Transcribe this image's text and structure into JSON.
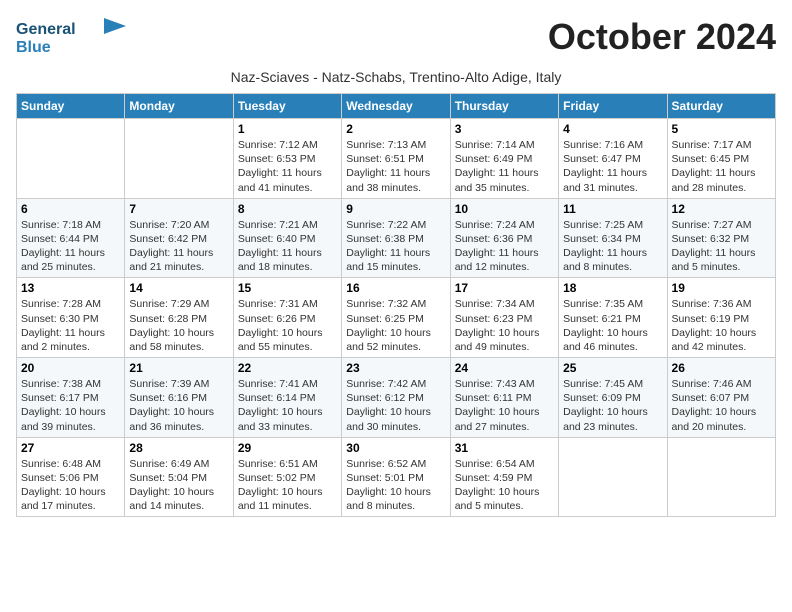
{
  "header": {
    "logo_line1": "General",
    "logo_line2": "Blue",
    "month_title": "October 2024",
    "subtitle": "Naz-Sciaves - Natz-Schabs, Trentino-Alto Adige, Italy"
  },
  "days_of_week": [
    "Sunday",
    "Monday",
    "Tuesday",
    "Wednesday",
    "Thursday",
    "Friday",
    "Saturday"
  ],
  "weeks": [
    [
      {
        "day": "",
        "detail": ""
      },
      {
        "day": "",
        "detail": ""
      },
      {
        "day": "1",
        "detail": "Sunrise: 7:12 AM\nSunset: 6:53 PM\nDaylight: 11 hours and 41 minutes."
      },
      {
        "day": "2",
        "detail": "Sunrise: 7:13 AM\nSunset: 6:51 PM\nDaylight: 11 hours and 38 minutes."
      },
      {
        "day": "3",
        "detail": "Sunrise: 7:14 AM\nSunset: 6:49 PM\nDaylight: 11 hours and 35 minutes."
      },
      {
        "day": "4",
        "detail": "Sunrise: 7:16 AM\nSunset: 6:47 PM\nDaylight: 11 hours and 31 minutes."
      },
      {
        "day": "5",
        "detail": "Sunrise: 7:17 AM\nSunset: 6:45 PM\nDaylight: 11 hours and 28 minutes."
      }
    ],
    [
      {
        "day": "6",
        "detail": "Sunrise: 7:18 AM\nSunset: 6:44 PM\nDaylight: 11 hours and 25 minutes."
      },
      {
        "day": "7",
        "detail": "Sunrise: 7:20 AM\nSunset: 6:42 PM\nDaylight: 11 hours and 21 minutes."
      },
      {
        "day": "8",
        "detail": "Sunrise: 7:21 AM\nSunset: 6:40 PM\nDaylight: 11 hours and 18 minutes."
      },
      {
        "day": "9",
        "detail": "Sunrise: 7:22 AM\nSunset: 6:38 PM\nDaylight: 11 hours and 15 minutes."
      },
      {
        "day": "10",
        "detail": "Sunrise: 7:24 AM\nSunset: 6:36 PM\nDaylight: 11 hours and 12 minutes."
      },
      {
        "day": "11",
        "detail": "Sunrise: 7:25 AM\nSunset: 6:34 PM\nDaylight: 11 hours and 8 minutes."
      },
      {
        "day": "12",
        "detail": "Sunrise: 7:27 AM\nSunset: 6:32 PM\nDaylight: 11 hours and 5 minutes."
      }
    ],
    [
      {
        "day": "13",
        "detail": "Sunrise: 7:28 AM\nSunset: 6:30 PM\nDaylight: 11 hours and 2 minutes."
      },
      {
        "day": "14",
        "detail": "Sunrise: 7:29 AM\nSunset: 6:28 PM\nDaylight: 10 hours and 58 minutes."
      },
      {
        "day": "15",
        "detail": "Sunrise: 7:31 AM\nSunset: 6:26 PM\nDaylight: 10 hours and 55 minutes."
      },
      {
        "day": "16",
        "detail": "Sunrise: 7:32 AM\nSunset: 6:25 PM\nDaylight: 10 hours and 52 minutes."
      },
      {
        "day": "17",
        "detail": "Sunrise: 7:34 AM\nSunset: 6:23 PM\nDaylight: 10 hours and 49 minutes."
      },
      {
        "day": "18",
        "detail": "Sunrise: 7:35 AM\nSunset: 6:21 PM\nDaylight: 10 hours and 46 minutes."
      },
      {
        "day": "19",
        "detail": "Sunrise: 7:36 AM\nSunset: 6:19 PM\nDaylight: 10 hours and 42 minutes."
      }
    ],
    [
      {
        "day": "20",
        "detail": "Sunrise: 7:38 AM\nSunset: 6:17 PM\nDaylight: 10 hours and 39 minutes."
      },
      {
        "day": "21",
        "detail": "Sunrise: 7:39 AM\nSunset: 6:16 PM\nDaylight: 10 hours and 36 minutes."
      },
      {
        "day": "22",
        "detail": "Sunrise: 7:41 AM\nSunset: 6:14 PM\nDaylight: 10 hours and 33 minutes."
      },
      {
        "day": "23",
        "detail": "Sunrise: 7:42 AM\nSunset: 6:12 PM\nDaylight: 10 hours and 30 minutes."
      },
      {
        "day": "24",
        "detail": "Sunrise: 7:43 AM\nSunset: 6:11 PM\nDaylight: 10 hours and 27 minutes."
      },
      {
        "day": "25",
        "detail": "Sunrise: 7:45 AM\nSunset: 6:09 PM\nDaylight: 10 hours and 23 minutes."
      },
      {
        "day": "26",
        "detail": "Sunrise: 7:46 AM\nSunset: 6:07 PM\nDaylight: 10 hours and 20 minutes."
      }
    ],
    [
      {
        "day": "27",
        "detail": "Sunrise: 6:48 AM\nSunset: 5:06 PM\nDaylight: 10 hours and 17 minutes."
      },
      {
        "day": "28",
        "detail": "Sunrise: 6:49 AM\nSunset: 5:04 PM\nDaylight: 10 hours and 14 minutes."
      },
      {
        "day": "29",
        "detail": "Sunrise: 6:51 AM\nSunset: 5:02 PM\nDaylight: 10 hours and 11 minutes."
      },
      {
        "day": "30",
        "detail": "Sunrise: 6:52 AM\nSunset: 5:01 PM\nDaylight: 10 hours and 8 minutes."
      },
      {
        "day": "31",
        "detail": "Sunrise: 6:54 AM\nSunset: 4:59 PM\nDaylight: 10 hours and 5 minutes."
      },
      {
        "day": "",
        "detail": ""
      },
      {
        "day": "",
        "detail": ""
      }
    ]
  ]
}
